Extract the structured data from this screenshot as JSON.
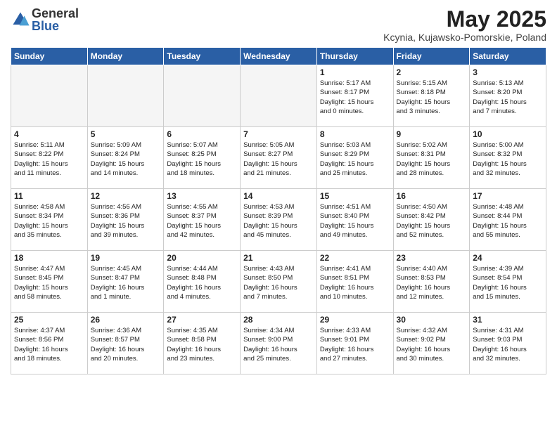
{
  "logo": {
    "general": "General",
    "blue": "Blue"
  },
  "title": "May 2025",
  "subtitle": "Kcynia, Kujawsko-Pomorskie, Poland",
  "headers": [
    "Sunday",
    "Monday",
    "Tuesday",
    "Wednesday",
    "Thursday",
    "Friday",
    "Saturday"
  ],
  "weeks": [
    [
      {
        "day": "",
        "empty": true
      },
      {
        "day": "",
        "empty": true
      },
      {
        "day": "",
        "empty": true
      },
      {
        "day": "",
        "empty": true
      },
      {
        "day": "1",
        "info": "Sunrise: 5:17 AM\nSunset: 8:17 PM\nDaylight: 15 hours\nand 0 minutes."
      },
      {
        "day": "2",
        "info": "Sunrise: 5:15 AM\nSunset: 8:18 PM\nDaylight: 15 hours\nand 3 minutes."
      },
      {
        "day": "3",
        "info": "Sunrise: 5:13 AM\nSunset: 8:20 PM\nDaylight: 15 hours\nand 7 minutes."
      }
    ],
    [
      {
        "day": "4",
        "info": "Sunrise: 5:11 AM\nSunset: 8:22 PM\nDaylight: 15 hours\nand 11 minutes."
      },
      {
        "day": "5",
        "info": "Sunrise: 5:09 AM\nSunset: 8:24 PM\nDaylight: 15 hours\nand 14 minutes."
      },
      {
        "day": "6",
        "info": "Sunrise: 5:07 AM\nSunset: 8:25 PM\nDaylight: 15 hours\nand 18 minutes."
      },
      {
        "day": "7",
        "info": "Sunrise: 5:05 AM\nSunset: 8:27 PM\nDaylight: 15 hours\nand 21 minutes."
      },
      {
        "day": "8",
        "info": "Sunrise: 5:03 AM\nSunset: 8:29 PM\nDaylight: 15 hours\nand 25 minutes."
      },
      {
        "day": "9",
        "info": "Sunrise: 5:02 AM\nSunset: 8:31 PM\nDaylight: 15 hours\nand 28 minutes."
      },
      {
        "day": "10",
        "info": "Sunrise: 5:00 AM\nSunset: 8:32 PM\nDaylight: 15 hours\nand 32 minutes."
      }
    ],
    [
      {
        "day": "11",
        "info": "Sunrise: 4:58 AM\nSunset: 8:34 PM\nDaylight: 15 hours\nand 35 minutes."
      },
      {
        "day": "12",
        "info": "Sunrise: 4:56 AM\nSunset: 8:36 PM\nDaylight: 15 hours\nand 39 minutes."
      },
      {
        "day": "13",
        "info": "Sunrise: 4:55 AM\nSunset: 8:37 PM\nDaylight: 15 hours\nand 42 minutes."
      },
      {
        "day": "14",
        "info": "Sunrise: 4:53 AM\nSunset: 8:39 PM\nDaylight: 15 hours\nand 45 minutes."
      },
      {
        "day": "15",
        "info": "Sunrise: 4:51 AM\nSunset: 8:40 PM\nDaylight: 15 hours\nand 49 minutes."
      },
      {
        "day": "16",
        "info": "Sunrise: 4:50 AM\nSunset: 8:42 PM\nDaylight: 15 hours\nand 52 minutes."
      },
      {
        "day": "17",
        "info": "Sunrise: 4:48 AM\nSunset: 8:44 PM\nDaylight: 15 hours\nand 55 minutes."
      }
    ],
    [
      {
        "day": "18",
        "info": "Sunrise: 4:47 AM\nSunset: 8:45 PM\nDaylight: 15 hours\nand 58 minutes."
      },
      {
        "day": "19",
        "info": "Sunrise: 4:45 AM\nSunset: 8:47 PM\nDaylight: 16 hours\nand 1 minute."
      },
      {
        "day": "20",
        "info": "Sunrise: 4:44 AM\nSunset: 8:48 PM\nDaylight: 16 hours\nand 4 minutes."
      },
      {
        "day": "21",
        "info": "Sunrise: 4:43 AM\nSunset: 8:50 PM\nDaylight: 16 hours\nand 7 minutes."
      },
      {
        "day": "22",
        "info": "Sunrise: 4:41 AM\nSunset: 8:51 PM\nDaylight: 16 hours\nand 10 minutes."
      },
      {
        "day": "23",
        "info": "Sunrise: 4:40 AM\nSunset: 8:53 PM\nDaylight: 16 hours\nand 12 minutes."
      },
      {
        "day": "24",
        "info": "Sunrise: 4:39 AM\nSunset: 8:54 PM\nDaylight: 16 hours\nand 15 minutes."
      }
    ],
    [
      {
        "day": "25",
        "info": "Sunrise: 4:37 AM\nSunset: 8:56 PM\nDaylight: 16 hours\nand 18 minutes."
      },
      {
        "day": "26",
        "info": "Sunrise: 4:36 AM\nSunset: 8:57 PM\nDaylight: 16 hours\nand 20 minutes."
      },
      {
        "day": "27",
        "info": "Sunrise: 4:35 AM\nSunset: 8:58 PM\nDaylight: 16 hours\nand 23 minutes."
      },
      {
        "day": "28",
        "info": "Sunrise: 4:34 AM\nSunset: 9:00 PM\nDaylight: 16 hours\nand 25 minutes."
      },
      {
        "day": "29",
        "info": "Sunrise: 4:33 AM\nSunset: 9:01 PM\nDaylight: 16 hours\nand 27 minutes."
      },
      {
        "day": "30",
        "info": "Sunrise: 4:32 AM\nSunset: 9:02 PM\nDaylight: 16 hours\nand 30 minutes."
      },
      {
        "day": "31",
        "info": "Sunrise: 4:31 AM\nSunset: 9:03 PM\nDaylight: 16 hours\nand 32 minutes."
      }
    ]
  ]
}
